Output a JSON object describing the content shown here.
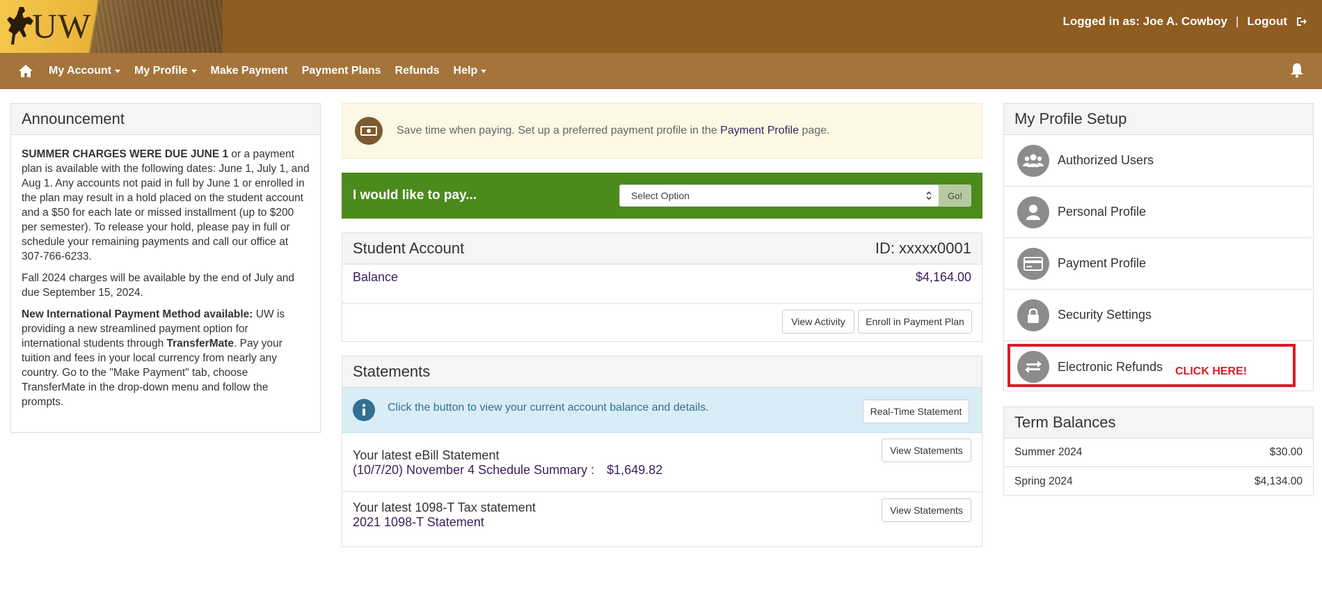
{
  "header": {
    "logo_text": "UW",
    "logged_in_as": "Logged in as: Joe A. Cowboy",
    "separator": "|",
    "logout": "Logout"
  },
  "nav": {
    "items": [
      {
        "label": "My Account",
        "dropdown": true
      },
      {
        "label": "My Profile",
        "dropdown": true
      },
      {
        "label": "Make Payment",
        "dropdown": false
      },
      {
        "label": "Payment Plans",
        "dropdown": false
      },
      {
        "label": "Refunds",
        "dropdown": false
      },
      {
        "label": "Help",
        "dropdown": true
      }
    ]
  },
  "announcement": {
    "title": "Announcement",
    "p1_bold": "SUMMER CHARGES WERE DUE JUNE 1",
    "p1_text": " or a payment plan is available with the following dates: June 1, July 1, and Aug 1. Any accounts not paid in full by June 1 or enrolled in the plan may result in a hold placed on the student account and a $50 for each late or missed installment (up to $200 per semester). To release your hold, please pay in full or schedule your remaining payments and call our office at 307-766-6233.",
    "p2_text": "Fall 2024 charges will be available by the end of July and due September 15, 2024.",
    "p3_bold": "New International Payment Method available:",
    "p3_text_a": " UW is providing a new streamlined payment option for international students through ",
    "p3_bold_b": "TransferMate",
    "p3_text_b": ". Pay your tuition and fees in your local currency from nearly any country. Go to the \"Make Payment\" tab, choose TransferMate in the drop-down menu and follow the prompts."
  },
  "promo": {
    "text_before": "Save time when paying. Set up a preferred payment profile in the ",
    "link": "Payment Profile",
    "text_after": " page."
  },
  "pay": {
    "label": "I would like to pay...",
    "select_value": "Select Option",
    "go": "Go!"
  },
  "student_account": {
    "title": "Student Account",
    "id": "ID: xxxxx0001",
    "balance_label": "Balance",
    "balance_value": "$4,164.00",
    "view_activity": "View Activity",
    "enroll_plan": "Enroll in Payment Plan"
  },
  "statements": {
    "title": "Statements",
    "info_text": "Click the button to view your current account balance and details.",
    "realtime_button": "Real-Time Statement",
    "ebill_title": "Your latest eBill Statement",
    "ebill_link": "(10/7/20) November 4 Schedule Summary :",
    "ebill_amount": "$1,649.82",
    "tax_title": "Your latest 1098-T Tax statement",
    "tax_link": "2021 1098-T Statement",
    "view_statements": "View Statements"
  },
  "profile_setup": {
    "title": "My Profile Setup",
    "items": [
      {
        "label": "Authorized Users",
        "icon": "users-icon"
      },
      {
        "label": "Personal Profile",
        "icon": "person-icon"
      },
      {
        "label": "Payment Profile",
        "icon": "credit-card-icon"
      },
      {
        "label": "Security Settings",
        "icon": "lock-icon"
      },
      {
        "label": "Electronic Refunds",
        "icon": "exchange-icon"
      }
    ],
    "click_here": "CLICK HERE!"
  },
  "term_balances": {
    "title": "Term Balances",
    "rows": [
      {
        "term": "Summer 2024",
        "amount": "$30.00"
      },
      {
        "term": "Spring 2024",
        "amount": "$4,134.00"
      }
    ]
  },
  "colors": {
    "header_brown": "#8f5c22",
    "nav_brown": "#a4743b",
    "pay_green": "#4b8a1c",
    "link_purple": "#3b1f5c",
    "highlight_red": "#d61d28"
  }
}
